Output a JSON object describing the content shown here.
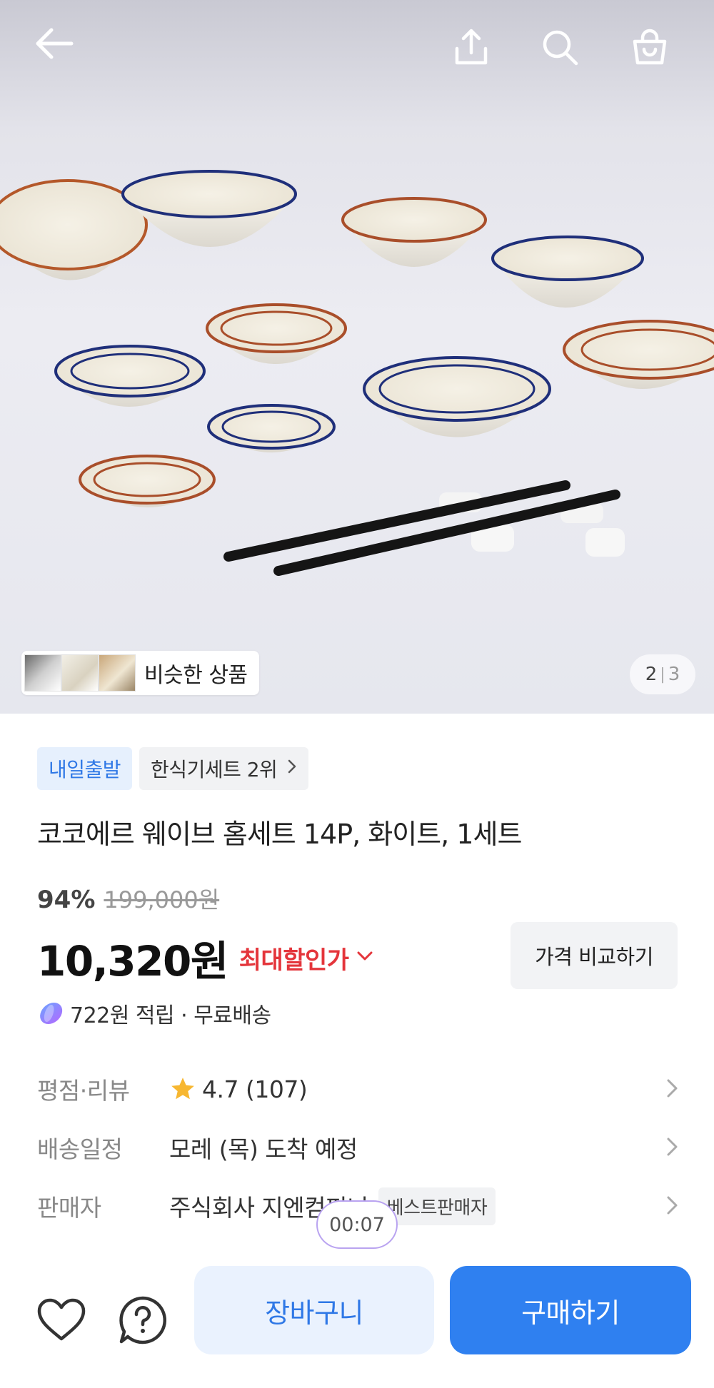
{
  "header": {
    "back_icon": "arrow-left-icon",
    "share_icon": "share-icon",
    "search_icon": "search-icon",
    "cart_icon": "shopping-bag-icon"
  },
  "gallery": {
    "similar_label": "비슷한 상품",
    "current": "2",
    "total": "3"
  },
  "product": {
    "badge_delivery": "내일출발",
    "badge_rank": "한식기세트 2위",
    "title": "코코에르 웨이브 홈세트 14P, 화이트, 1세트",
    "discount_rate": "94%",
    "original_price": "199,000원",
    "price": "10,320원",
    "max_discount_label": "최대할인가",
    "compare_label": "가격 비교하기",
    "points_text": "722원 적립 · 무료배송"
  },
  "info": {
    "rating_key": "평점·리뷰",
    "rating_value": "4.7 (107)",
    "delivery_key": "배송일정",
    "delivery_value": "모레 (목) 도착 예정",
    "seller_key": "판매자",
    "seller_value": "주식회사 지엔컴퍼니",
    "seller_badge": "베스트판매자"
  },
  "timer": "00:07",
  "bottom_bar": {
    "like_icon": "heart-icon",
    "question_icon": "question-icon",
    "cart_label": "장바구니",
    "buy_label": "구매하기"
  },
  "colors": {
    "accent_blue": "#2f80f0",
    "discount_red": "#e4353b",
    "star_yellow": "#f7b731"
  }
}
